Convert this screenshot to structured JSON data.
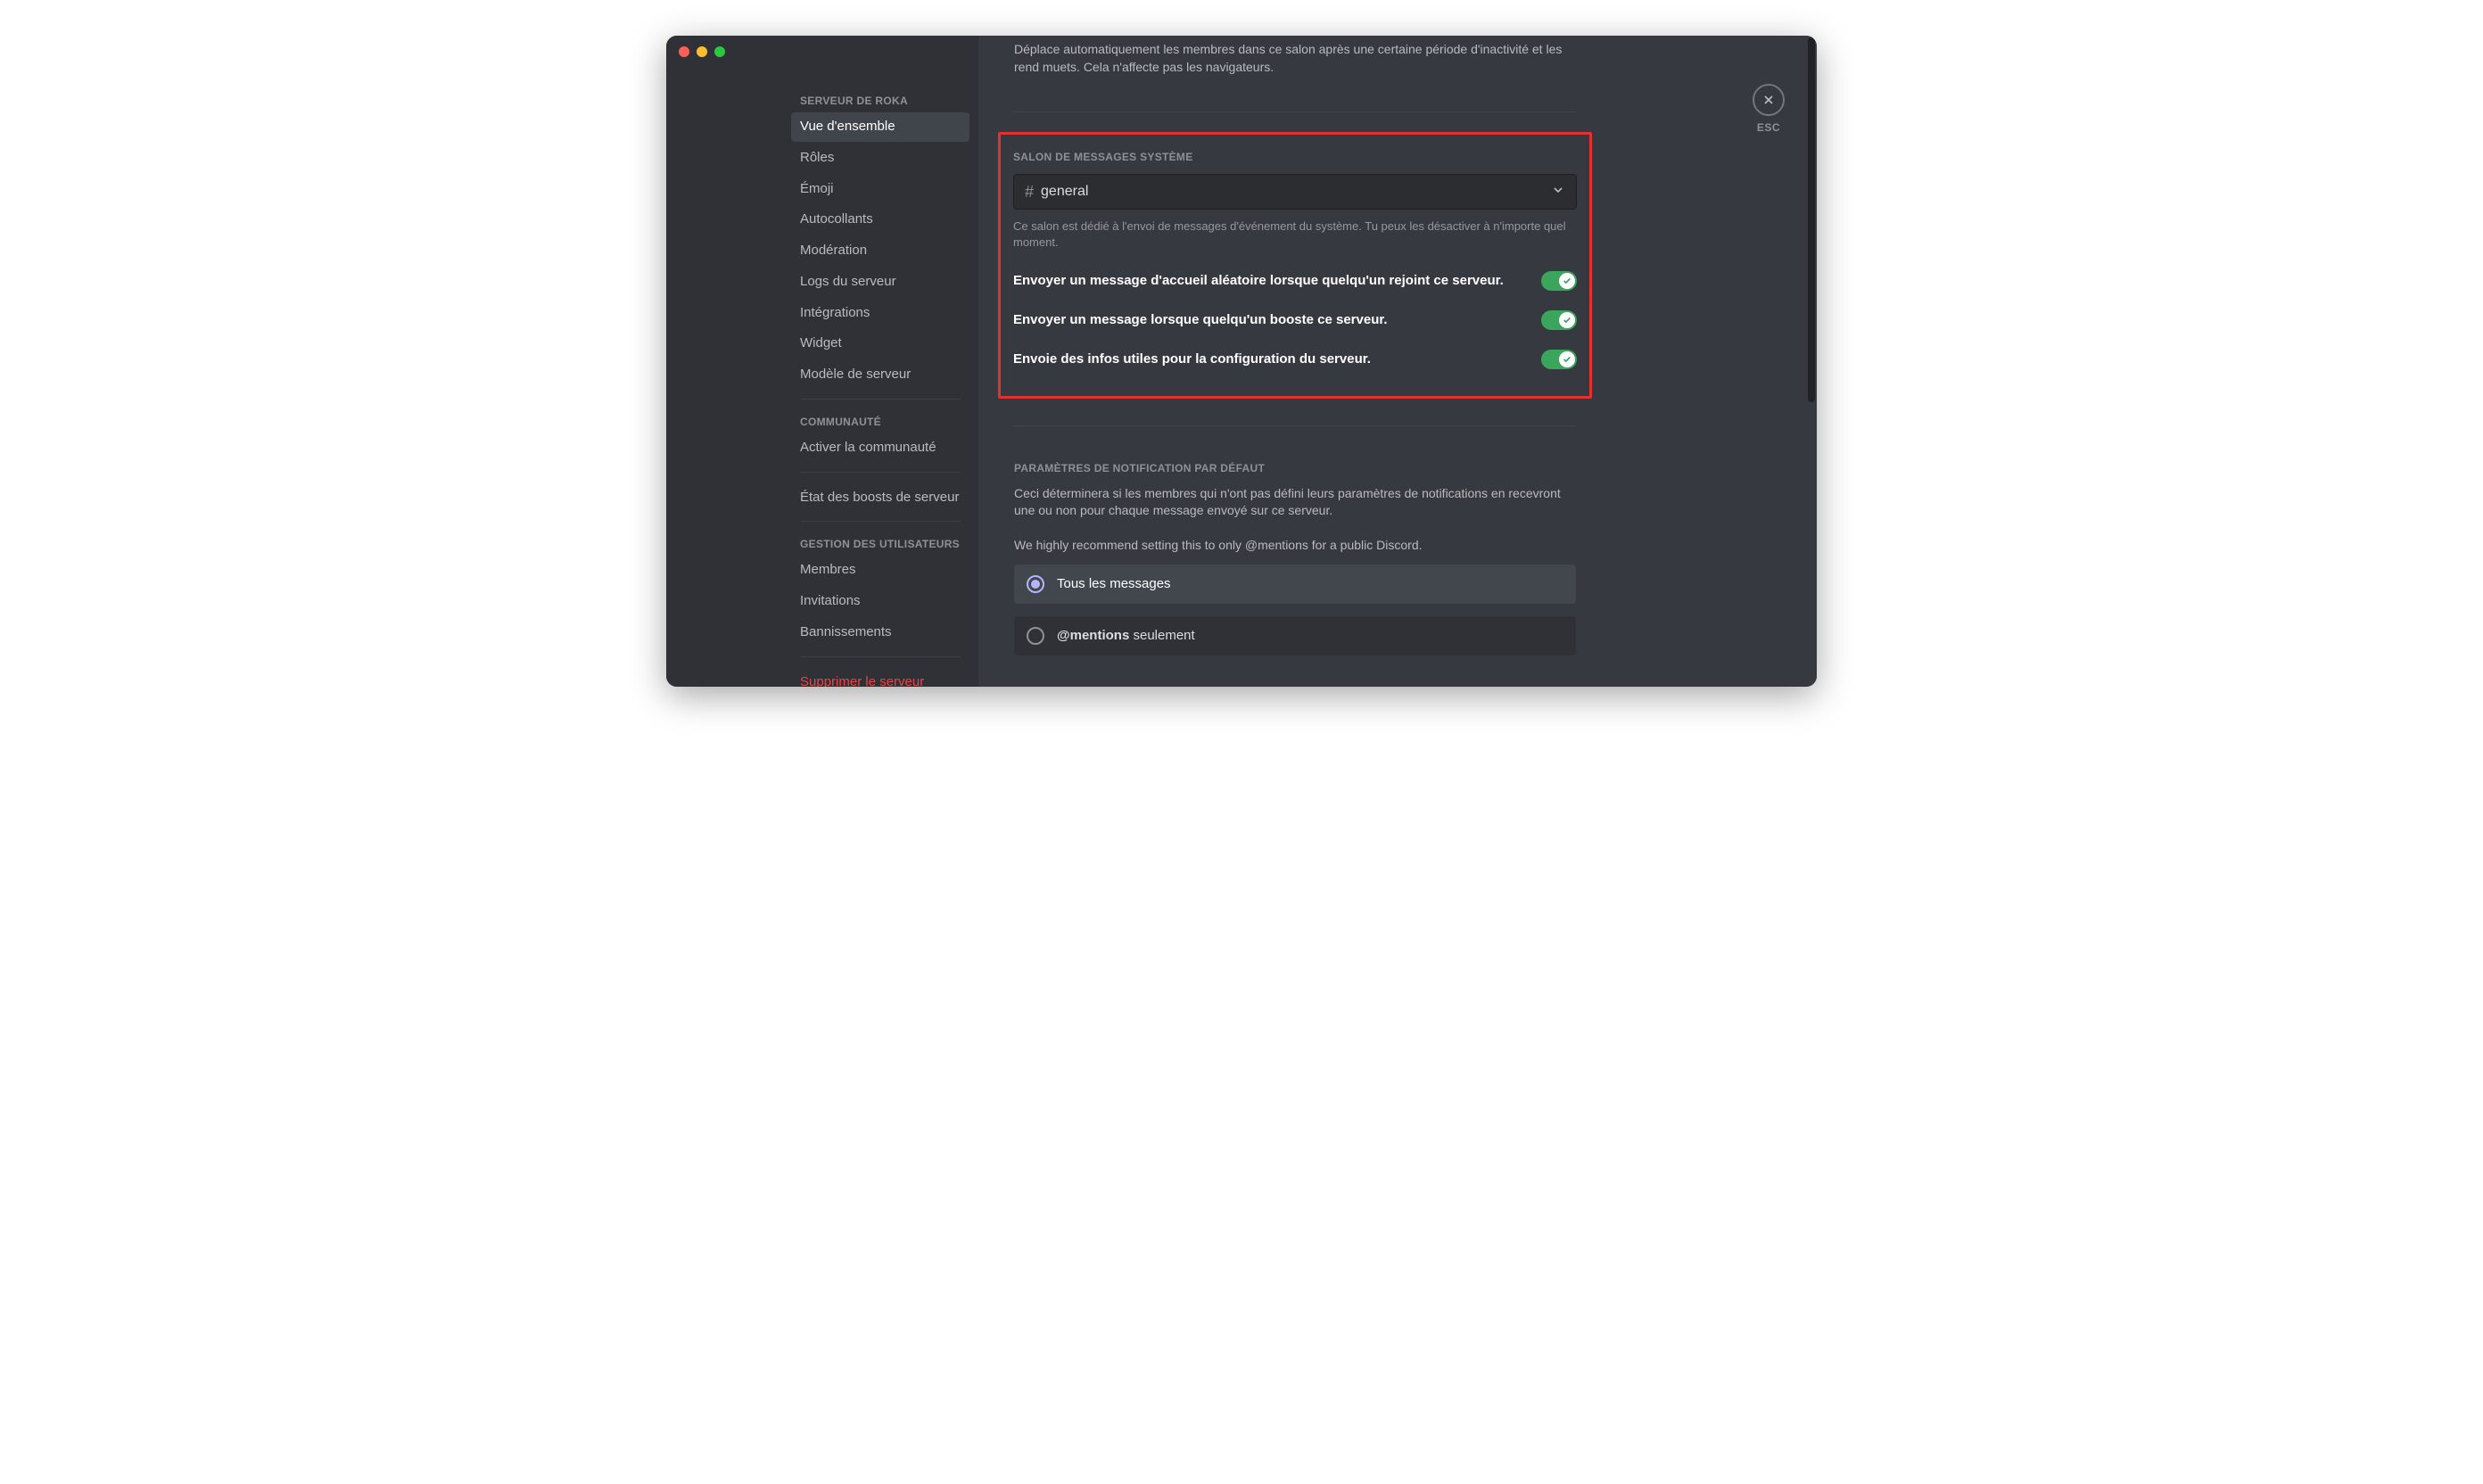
{
  "sidebar": {
    "server_header": "SERVEUR DE ROKA",
    "items1": [
      "Vue d'ensemble",
      "Rôles",
      "Émoji",
      "Autocollants",
      "Modération",
      "Logs du serveur",
      "Intégrations",
      "Widget",
      "Modèle de serveur"
    ],
    "community_header": "COMMUNAUTÉ",
    "items2": [
      "Activer la communauté"
    ],
    "boost_item": "État des boosts de serveur",
    "users_header": "GESTION DES UTILISATEURS",
    "items3": [
      "Membres",
      "Invitations",
      "Bannissements"
    ],
    "delete": "Supprimer le serveur"
  },
  "content": {
    "afk_desc": "Déplace automatiquement les membres dans ce salon après une certaine période d'inactivité et les rend muets. Cela n'affecte pas les navigateurs.",
    "system_title": "SALON DE MESSAGES SYSTÈME",
    "system_channel": "general",
    "system_help": "Ce salon est dédié à l'envoi de messages d'événement du système. Tu peux les désactiver à n'importe quel moment.",
    "toggle1": "Envoyer un message d'accueil aléatoire lorsque quelqu'un rejoint ce serveur.",
    "toggle2": "Envoyer un message lorsque quelqu'un booste ce serveur.",
    "toggle3": "Envoie des infos utiles pour la configuration du serveur.",
    "notif_title": "PARAMÈTRES DE NOTIFICATION PAR DÉFAUT",
    "notif_desc": "Ceci déterminera si les membres qui n'ont pas défini leurs paramètres de notifications en recevront une ou non pour chaque message envoyé sur ce serveur.",
    "notif_recommend": "We highly recommend setting this to only @mentions for a public Discord.",
    "radio_all": "Tous les messages",
    "radio_mentions_strong": "@mentions",
    "radio_mentions_rest": " seulement"
  },
  "close": {
    "label": "ESC"
  }
}
